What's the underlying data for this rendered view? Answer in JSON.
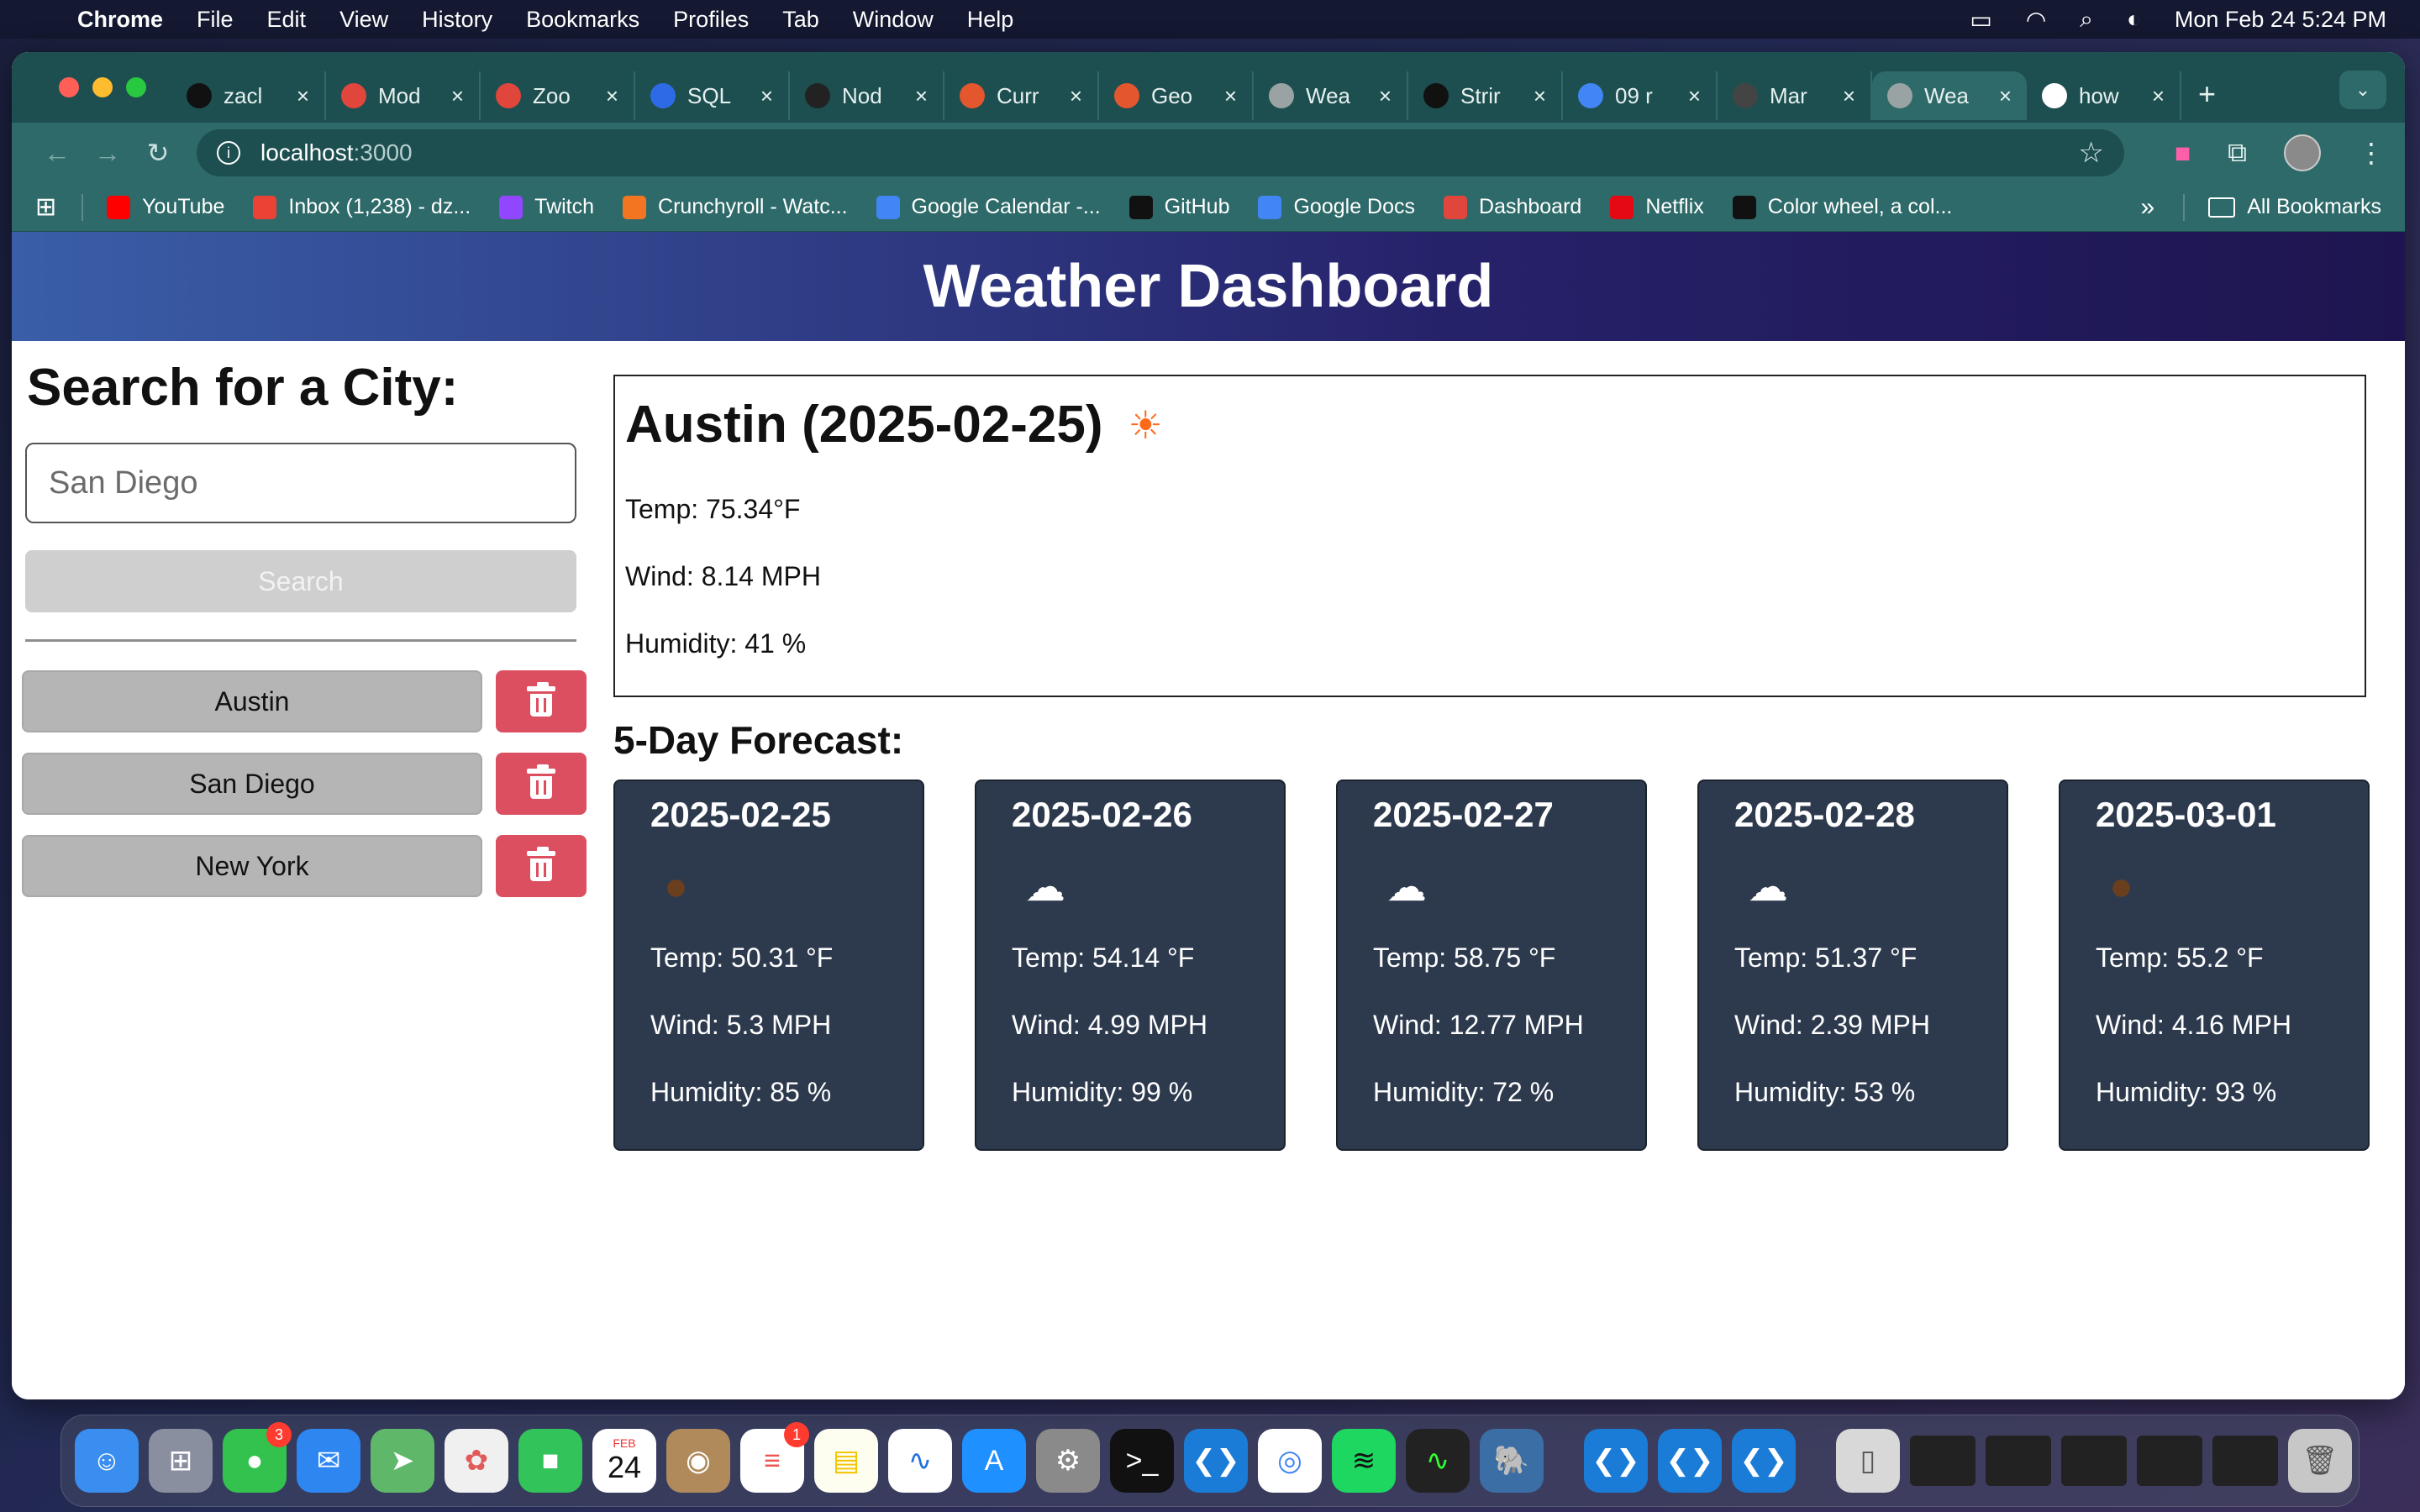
{
  "menubar": {
    "app": "Chrome",
    "items": [
      "File",
      "Edit",
      "View",
      "History",
      "Bookmarks",
      "Profiles",
      "Tab",
      "Window",
      "Help"
    ],
    "datetime": "Mon Feb 24  5:24 PM"
  },
  "browser": {
    "tabs": [
      {
        "title": "zacl",
        "icon": "github-icon",
        "color": "#111111"
      },
      {
        "title": "Mod",
        "icon": "canvas-icon",
        "color": "#e0463b"
      },
      {
        "title": "Zoo",
        "icon": "canvas-icon",
        "color": "#e0463b"
      },
      {
        "title": "SQL",
        "icon": "zoom-icon",
        "color": "#2d6be6"
      },
      {
        "title": "Nod",
        "icon": "openai-icon",
        "color": "#222222"
      },
      {
        "title": "Curr",
        "icon": "edx-icon",
        "color": "#e4572e"
      },
      {
        "title": "Geo",
        "icon": "edx-icon",
        "color": "#e4572e"
      },
      {
        "title": "Wea",
        "icon": "globe-icon",
        "color": "#9aa3a3"
      },
      {
        "title": "Strir",
        "icon": "mongo-icon",
        "color": "#111111"
      },
      {
        "title": "09 r",
        "icon": "docs-icon",
        "color": "#4285f4"
      },
      {
        "title": "Mar",
        "icon": "markdown-icon",
        "color": "#444444"
      },
      {
        "title": "Wea",
        "icon": "globe-icon",
        "color": "#9aa3a3",
        "active": true
      },
      {
        "title": "how",
        "icon": "google-icon",
        "color": "#ffffff"
      }
    ],
    "url_host": "localhost",
    "url_port": ":3000",
    "bookmarks": [
      {
        "label": "YouTube",
        "icon": "youtube-icon",
        "color": "#ff0000"
      },
      {
        "label": "Inbox (1,238) - dz...",
        "icon": "gmail-icon",
        "color": "#ea4335"
      },
      {
        "label": "Twitch",
        "icon": "twitch-icon",
        "color": "#9146ff"
      },
      {
        "label": "Crunchyroll - Watc...",
        "icon": "crunchyroll-icon",
        "color": "#f47521"
      },
      {
        "label": "Google Calendar -...",
        "icon": "calendar-icon",
        "color": "#4285f4"
      },
      {
        "label": "GitHub",
        "icon": "github-icon",
        "color": "#111111"
      },
      {
        "label": "Google Docs",
        "icon": "docs-icon",
        "color": "#4285f4"
      },
      {
        "label": "Dashboard",
        "icon": "canvas-icon",
        "color": "#e0463b"
      },
      {
        "label": "Netflix",
        "icon": "netflix-icon",
        "color": "#e50914"
      },
      {
        "label": "Color wheel, a col...",
        "icon": "colorwheel-icon",
        "color": "#111111"
      }
    ],
    "all_bookmarks": "All Bookmarks"
  },
  "page": {
    "title": "Weather Dashboard",
    "search": {
      "heading": "Search for a City:",
      "placeholder": "San Diego",
      "button": "Search"
    },
    "history": [
      "Austin",
      "San Diego",
      "New York"
    ],
    "today": {
      "heading": "Austin (2025-02-25)",
      "icon": "☀",
      "temp": "Temp: 75.34°F",
      "wind": "Wind: 8.14 MPH",
      "humidity": "Humidity: 41 %"
    },
    "forecast_title": "5-Day Forecast:",
    "forecast": [
      {
        "date": "2025-02-25",
        "icon": "●",
        "temp": "Temp: 50.31 °F",
        "wind": "Wind: 5.3 MPH",
        "humidity": "Humidity: 85 %"
      },
      {
        "date": "2025-02-26",
        "icon": "☁",
        "temp": "Temp: 54.14 °F",
        "wind": "Wind: 4.99 MPH",
        "humidity": "Humidity: 99 %"
      },
      {
        "date": "2025-02-27",
        "icon": "☁",
        "temp": "Temp: 58.75 °F",
        "wind": "Wind: 12.77 MPH",
        "humidity": "Humidity: 72 %"
      },
      {
        "date": "2025-02-28",
        "icon": "☁",
        "temp": "Temp: 51.37 °F",
        "wind": "Wind: 2.39 MPH",
        "humidity": "Humidity: 53 %"
      },
      {
        "date": "2025-03-01",
        "icon": "●",
        "temp": "Temp: 55.2 °F",
        "wind": "Wind: 4.16 MPH",
        "humidity": "Humidity: 93 %"
      }
    ]
  },
  "dock": {
    "messages_badge": "3",
    "calendar_month": "FEB",
    "calendar_day": "24",
    "reminders_badge": "1"
  }
}
